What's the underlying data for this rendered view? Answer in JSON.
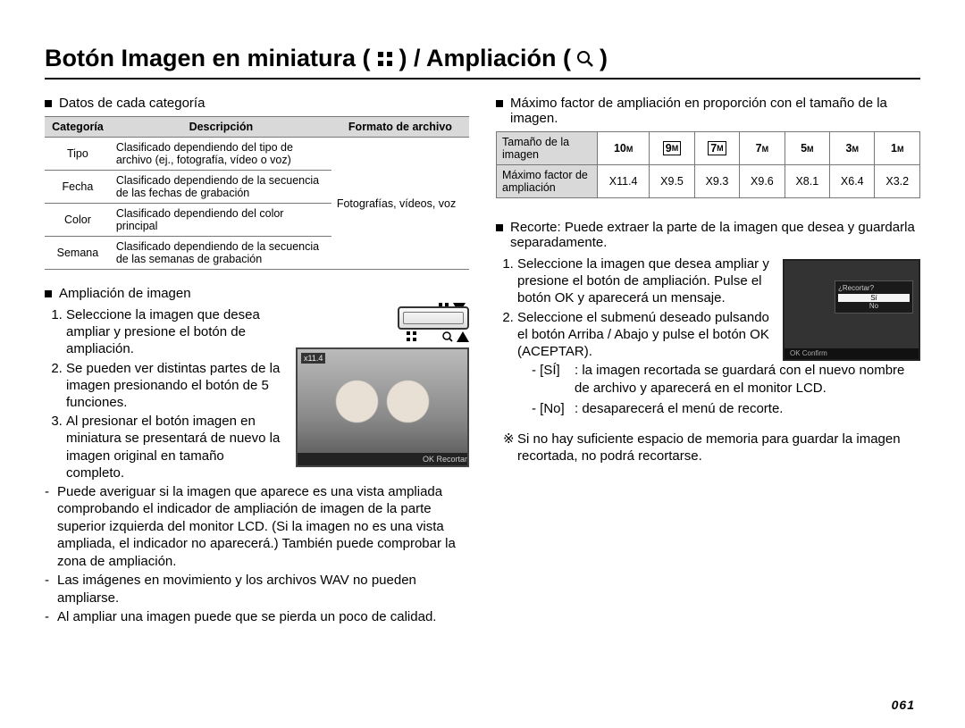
{
  "title": {
    "part1": "Botón Imagen en miniatura ( ",
    "part2": " ) / Ampliación ( ",
    "part3": " )"
  },
  "page_number": "061",
  "left": {
    "h1": "Datos de cada categoría",
    "table": {
      "head": {
        "c1": "Categoría",
        "c2": "Descripción",
        "c3": "Formato de archivo"
      },
      "rows": [
        {
          "c1": "Tipo",
          "c2": "Clasificado dependiendo del tipo de archivo (ej., fotografía, vídeo o voz)"
        },
        {
          "c1": "Fecha",
          "c2": "Clasificado dependiendo de la secuencia de las fechas de grabación"
        },
        {
          "c1": "Color",
          "c2": "Clasificado dependiendo del color principal"
        },
        {
          "c1": "Semana",
          "c2": "Clasificado dependiendo de la secuencia de las semanas de grabación"
        }
      ],
      "c3": "Fotografías, vídeos, voz"
    },
    "h2": "Ampliación de imagen",
    "step1": "Seleccione la imagen que desea ampliar y presione el botón de ampliación.",
    "step2": "Se pueden ver distintas partes de la imagen presionando el botón de 5 funciones.",
    "step3": "Al presionar el botón imagen en miniatura se presentará de nuevo la imagen original en tamaño completo.",
    "sub1": "Puede averiguar si la imagen que aparece es una vista ampliada comprobando el indicador de ampliación de imagen de la parte superior izquierda del monitor LCD. (Si la imagen no es una vista ampliada, el indicador no aparecerá.) También puede comprobar la zona de ampliación.",
    "sub2": "Las imágenes en movimiento y los archivos WAV no pueden ampliarse.",
    "sub3": "Al ampliar una imagen puede que se pierda un poco de calidad.",
    "img_zoom": "x11.4",
    "img_bar": "OK  Recortar"
  },
  "right": {
    "h1": "Máximo factor de ampliación en proporción con el tamaño de la imagen.",
    "zoom": {
      "rowh1": "Tamaño de la imagen",
      "rowh2": "Máximo factor de ampliación",
      "sizes": [
        "10",
        "9",
        "7",
        "7",
        "5",
        "3",
        "1"
      ],
      "boxed": [
        false,
        true,
        true,
        false,
        false,
        false,
        false
      ],
      "factors": [
        "X11.4",
        "X9.5",
        "X9.3",
        "X9.6",
        "X8.1",
        "X6.4",
        "X3.2"
      ]
    },
    "h2": "Recorte: Puede extraer la parte de la imagen que desea y guardarla separadamente.",
    "step1": "Seleccione la imagen que desea ampliar y presione el botón de ampliación. Pulse el botón OK y aparecerá un mensaje.",
    "step2": "Seleccione el submenú deseado pulsando el botón Arriba / Abajo y pulse el botón OK (ACEPTAR).",
    "si_l": "- [SÍ]",
    "si_r": ": la imagen recortada se guardará con el nuevo nombre de archivo y aparecerá en el monitor LCD.",
    "no_l": "- [No]",
    "no_r": ": desaparecerá el menú de recorte.",
    "note": "Si no hay suficiente espacio de memoria para guardar la imagen recortada, no podrá recortarse.",
    "dlg": {
      "title": "¿Recortar?",
      "yes": "Sí",
      "no": "No",
      "bar": "OK  Confirm"
    }
  }
}
